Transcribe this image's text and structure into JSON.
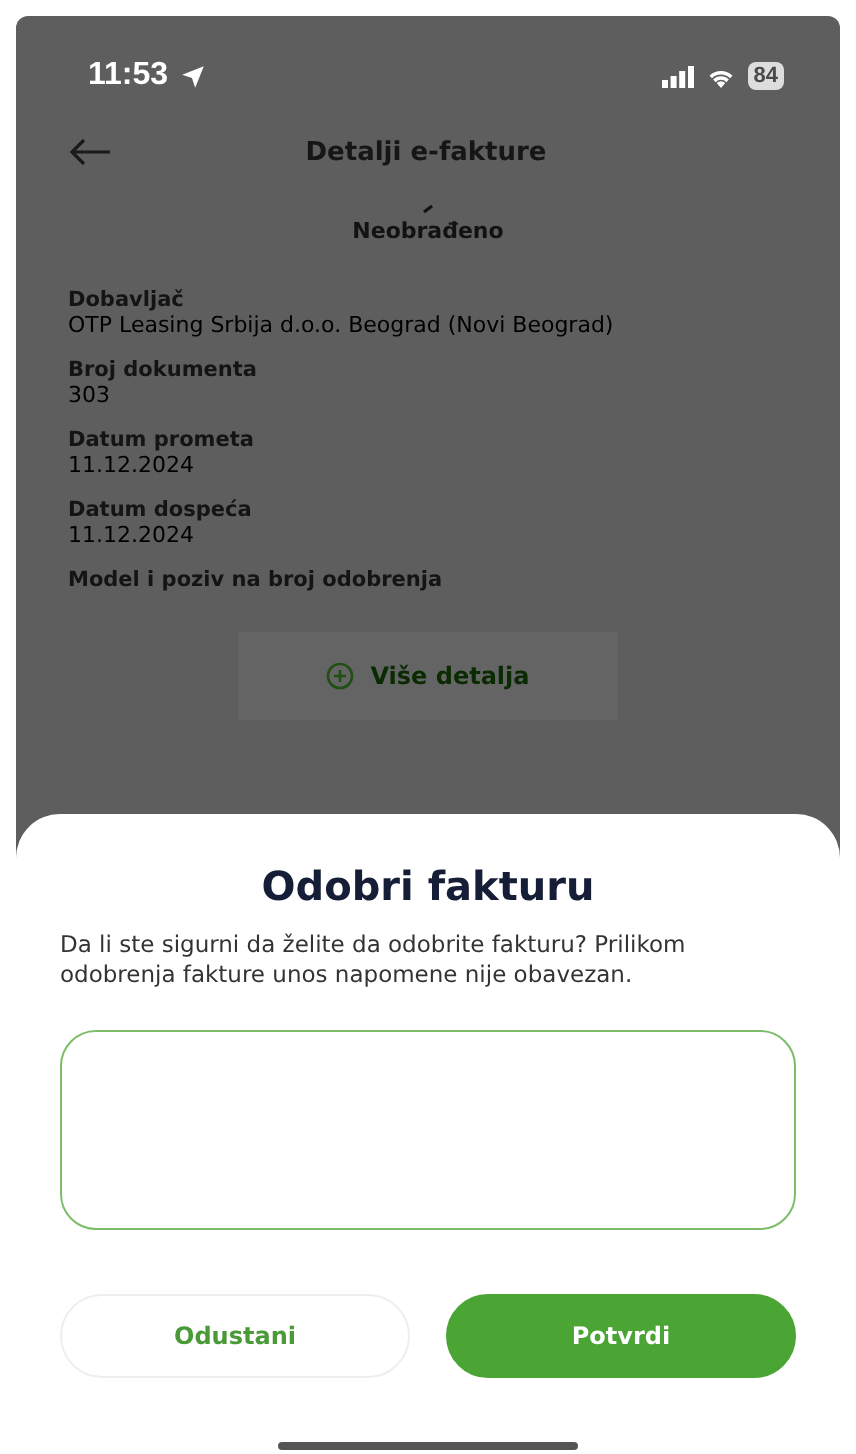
{
  "status_bar": {
    "time": "11:53",
    "battery": "84"
  },
  "header": {
    "title": "Detalji e-fakture"
  },
  "status": {
    "label": "Neobrađeno"
  },
  "fields": [
    {
      "label": "Dobavljač",
      "value": "OTP Leasing Srbija d.o.o. Beograd (Novi Beograd)"
    },
    {
      "label": "Broj dokumenta",
      "value": "303"
    },
    {
      "label": "Datum prometa",
      "value": "11.12.2024"
    },
    {
      "label": "Datum dospeća",
      "value": "11.12.2024"
    },
    {
      "label": "Model i poziv na broj odobrenja"
    }
  ],
  "more_button": {
    "label": "Više detalja"
  },
  "dialog": {
    "title": "Odobri fakturu",
    "message": "Da li ste sigurni da želite da odobrite fakturu? Prilikom odobrenja fakture unos napomene nije obavezan.",
    "buttons": [
      {
        "label": "Odustani",
        "kind": "secondary"
      },
      {
        "label": "Potvrdi",
        "kind": "primary"
      }
    ]
  }
}
